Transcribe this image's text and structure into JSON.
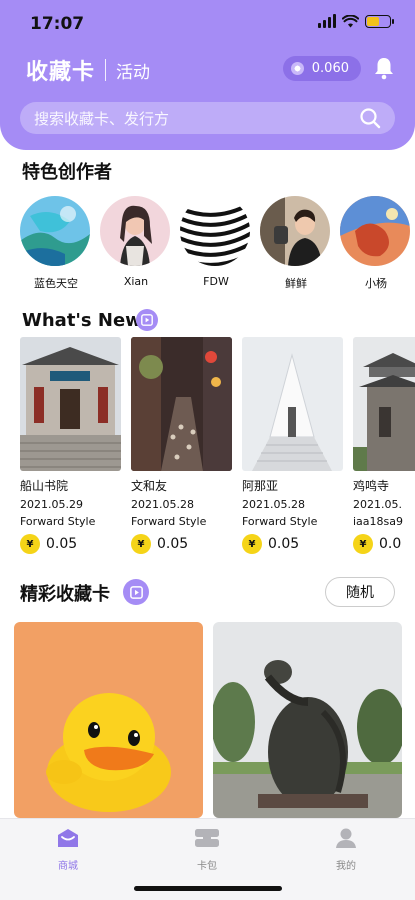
{
  "status_bar": {
    "time": "17:07"
  },
  "header": {
    "title": "收藏卡",
    "tab": "活动",
    "balance": "0.060",
    "search_placeholder": "搜索收藏卡、发行方"
  },
  "featured_creators": {
    "title": "特色创作者",
    "items": [
      {
        "name": "蓝色天空"
      },
      {
        "name": "Xian"
      },
      {
        "name": "FDW"
      },
      {
        "name": "鲜鲜"
      },
      {
        "name": "小杨"
      }
    ]
  },
  "whats_new": {
    "title": "What's New",
    "cards": [
      {
        "title": "船山书院",
        "date": "2021.05.29",
        "style": "Forward Style",
        "price": "0.05"
      },
      {
        "title": "文和友",
        "date": "2021.05.28",
        "style": "Forward Style",
        "price": "0.05"
      },
      {
        "title": "阿那亚",
        "date": "2021.05.28",
        "style": "Forward Style",
        "price": "0.05"
      },
      {
        "title": "鸡鸣寺",
        "date": "2021.05.",
        "style": "iaa18sa9",
        "price": "0.0"
      }
    ]
  },
  "featured_cards": {
    "title": "精彩收藏卡",
    "random_label": "随机"
  },
  "currency_symbol": "¥",
  "bottom_nav": {
    "items": [
      {
        "label": "商城"
      },
      {
        "label": "卡包"
      },
      {
        "label": "我的"
      }
    ]
  },
  "colors": {
    "accent": "#a58cf5",
    "coin": "#f5d418"
  }
}
